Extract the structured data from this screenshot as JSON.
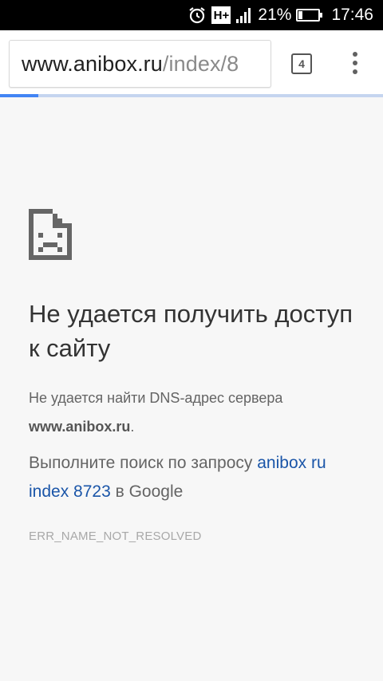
{
  "status_bar": {
    "battery_percent": "21%",
    "time": "17:46",
    "network_type": "H+",
    "icons": [
      "alarm-icon",
      "network-type-icon",
      "signal-icon",
      "battery-icon"
    ]
  },
  "toolbar": {
    "url_host": "www.anibox.ru",
    "url_path": "/index/8",
    "tab_count": "4"
  },
  "error_page": {
    "icon": "sad-page-icon",
    "title": "Не удается получить доступ к сайту",
    "detail_prefix": "Не удается найти DNS-адрес сервера",
    "detail_host": "www.anibox.ru",
    "detail_suffix": ".",
    "suggest_prefix": "Выполните поиск по запросу ",
    "suggest_link": "anibox ru index 8723",
    "suggest_suffix": " в Google",
    "error_code": "ERR_NAME_NOT_RESOLVED"
  },
  "colors": {
    "link": "#1a55a8",
    "progress": "#4285f4",
    "page_background": "#f7f7f7"
  }
}
